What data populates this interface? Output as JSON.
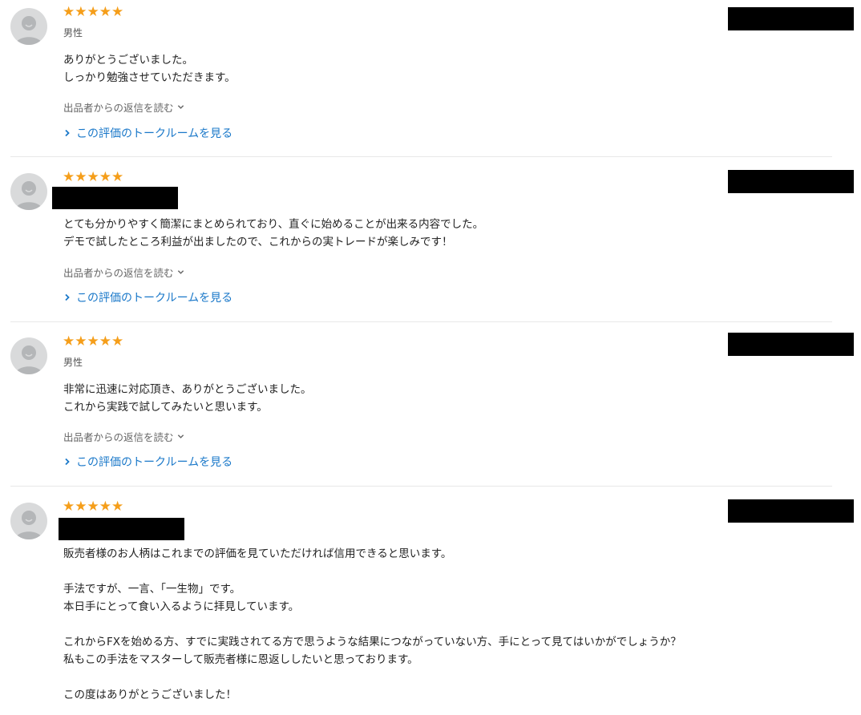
{
  "reviews": [
    {
      "stars": "★★★★★",
      "rating": 5,
      "gender": "男性",
      "comment": [
        "ありがとうございました。",
        "しっかり勉強させていただきます。"
      ],
      "reply_label": "出品者からの返信を読む",
      "talk_label": "この評価のトークルームを見る"
    },
    {
      "stars": "★★★★★",
      "rating": 5,
      "gender": "",
      "comment": [
        "とても分かりやすく簡潔にまとめられており、直ぐに始めることが出来る内容でした。",
        "デモで試したところ利益が出ましたので、これからの実トレードが楽しみです！"
      ],
      "reply_label": "出品者からの返信を読む",
      "talk_label": "この評価のトークルームを見る"
    },
    {
      "stars": "★★★★★",
      "rating": 5,
      "gender": "男性",
      "comment": [
        "非常に迅速に対応頂き、ありがとうございました。",
        "これから実践で試してみたいと思います。"
      ],
      "reply_label": "出品者からの返信を読む",
      "talk_label": "この評価のトークルームを見る"
    },
    {
      "stars": "★★★★★",
      "rating": 5,
      "gender": "",
      "comment": [
        "販売者様のお人柄はこれまでの評価を見ていただければ信用できると思います。",
        "",
        "手法ですが、一言、「一生物」です。",
        "本日手にとって食い入るように拝見しています。",
        "",
        "これからFXを始める方、すでに実践されてる方で思うような結果につながっていない方、手にとって見てはいかがでしょうか？",
        "私もこの手法をマスターして販売者様に恩返ししたいと思っております。",
        "",
        "この度はありがとうございました！"
      ]
    }
  ],
  "colors": {
    "star": "#f59e1a",
    "link": "#1a78c9",
    "avatar_bg": "#d9dadb",
    "avatar_fg": "#b4b6b8",
    "divider": "#e8e8e8"
  },
  "icons": {
    "avatar": "default-user-icon",
    "reply_chevron": "chevron-down-icon",
    "talk_arrow": "chevron-right-icon"
  }
}
